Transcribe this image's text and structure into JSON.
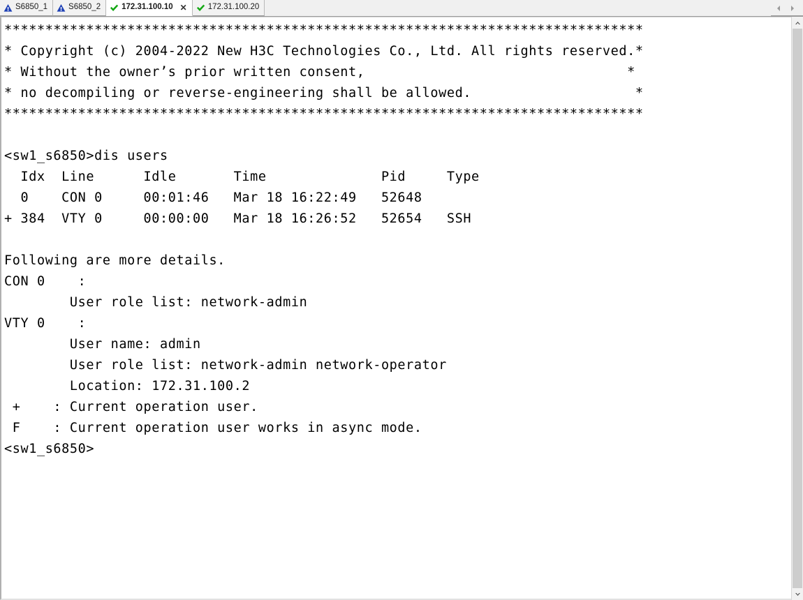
{
  "tabbar": {
    "tabs": [
      {
        "label": "S6850_1",
        "status_icon": "warning-triangle-icon",
        "active": false,
        "closable": false
      },
      {
        "label": "S6850_2",
        "status_icon": "warning-triangle-icon",
        "active": false,
        "closable": false
      },
      {
        "label": "172.31.100.10",
        "status_icon": "connected-check-icon",
        "active": true,
        "closable": true
      },
      {
        "label": "172.31.100.20",
        "status_icon": "connected-check-icon",
        "active": false,
        "closable": false
      }
    ],
    "close_label": "✕",
    "nav_prev_icon": "chevron-left-icon",
    "nav_next_icon": "chevron-right-icon",
    "colors": {
      "warning_blue": "#1F41B5",
      "connected_green": "#14A814",
      "active_tab_bg": "#ffffff",
      "inactive_tab_bg": "#f2f2f2",
      "bar_bg": "#f0f0f0"
    }
  },
  "terminal": {
    "background": "#ffffff",
    "foreground": "#000000",
    "lines": [
      "******************************************************************************",
      "* Copyright (c) 2004-2022 New H3C Technologies Co., Ltd. All rights reserved.*",
      "* Without the owner’s prior written consent,                                *",
      "* no decompiling or reverse-engineering shall be allowed.                    *",
      "******************************************************************************",
      "",
      "<sw1_s6850>dis users",
      "  Idx  Line      Idle       Time              Pid     Type",
      "  0    CON 0     00:01:46   Mar 18 16:22:49   52648",
      "+ 384  VTY 0     00:00:00   Mar 18 16:26:52   52654   SSH",
      "",
      "Following are more details.",
      "CON 0    :",
      "        User role list: network-admin",
      "VTY 0    :",
      "        User name: admin",
      "        User role list: network-admin network-operator",
      "        Location: 172.31.100.2",
      " +    : Current operation user.",
      " F    : Current operation user works in async mode.",
      "<sw1_s6850>"
    ],
    "prompt": "<sw1_s6850>",
    "command": "dis users",
    "users_table": {
      "columns": [
        "Idx",
        "Line",
        "Idle",
        "Time",
        "Pid",
        "Type"
      ],
      "rows": [
        {
          "flag": "",
          "Idx": "0",
          "Line": "CON 0",
          "Idle": "00:01:46",
          "Time": "Mar 18 16:22:49",
          "Pid": "52648",
          "Type": ""
        },
        {
          "flag": "+",
          "Idx": "384",
          "Line": "VTY 0",
          "Idle": "00:00:00",
          "Time": "Mar 18 16:26:52",
          "Pid": "52654",
          "Type": "SSH"
        }
      ]
    },
    "details": {
      "heading": "Following are more details.",
      "entries": [
        {
          "line": "CON 0",
          "user_role_list": "network-admin"
        },
        {
          "line": "VTY 0",
          "user_name": "admin",
          "user_role_list": "network-admin network-operator",
          "location": "172.31.100.2"
        }
      ],
      "legend": [
        {
          "symbol": "+",
          "text": "Current operation user."
        },
        {
          "symbol": "F",
          "text": "Current operation user works in async mode."
        }
      ]
    }
  },
  "scrollbar": {
    "up_icon": "chevron-up-icon",
    "down_icon": "chevron-down-icon",
    "thumb_top_pct": 0,
    "thumb_height_pct": 100
  }
}
